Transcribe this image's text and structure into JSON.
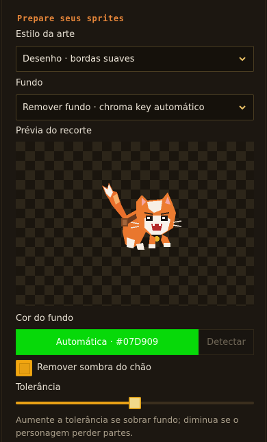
{
  "panel": {
    "heading": "Prepare seus sprites",
    "art_style": {
      "label": "Estilo da arte",
      "selected": "Desenho · bordas suaves"
    },
    "background": {
      "label": "Fundo",
      "selected": "Remover fundo · chroma key automático"
    },
    "preview": {
      "label": "Prévia do recorte"
    },
    "bg_color": {
      "label": "Cor do fundo",
      "value_button": "Automática · #07D909",
      "color": "#07D909",
      "detect_button": "Detectar"
    },
    "remove_shadow": {
      "label": "Remover sombra do chão",
      "checked": true
    },
    "tolerance": {
      "label": "Tolerância",
      "value": 0.5,
      "hint": "Aumente a tolerância se sobrar fundo; diminua se o personagem perder partes."
    }
  },
  "colors": {
    "accent": "#E8873A",
    "slider": "#E8A016"
  }
}
